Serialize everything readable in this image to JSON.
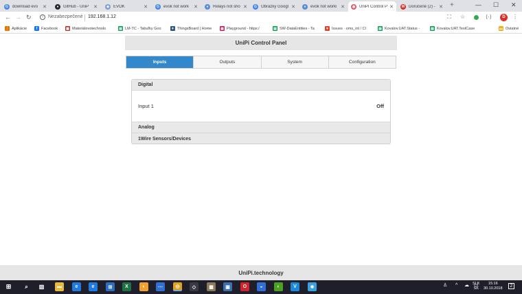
{
  "browser": {
    "tabs": [
      {
        "title": "download evo",
        "favicon": "google-icon",
        "color": "#4285f4",
        "glyph": "G"
      },
      {
        "title": "GitHub - UniP",
        "favicon": "github-icon",
        "color": "#24292e",
        "glyph": "●"
      },
      {
        "title": "EVOK",
        "favicon": "evok-icon",
        "color": "#7aa0d8",
        "glyph": "◆"
      },
      {
        "title": "evok not work",
        "favicon": "google-icon",
        "color": "#4285f4",
        "glyph": "G"
      },
      {
        "title": "Relays not sho",
        "favicon": "forum-icon",
        "color": "#5b8dd6",
        "glyph": "♦"
      },
      {
        "title": "Obrázky Googl",
        "favicon": "google-icon",
        "color": "#4285f4",
        "glyph": "G"
      },
      {
        "title": "evok not worki",
        "favicon": "forum-icon",
        "color": "#5b8dd6",
        "glyph": "♦"
      },
      {
        "title": "UniPi Control P",
        "favicon": "unipi-icon",
        "color": "#e05a6a",
        "glyph": "◉",
        "active": true
      },
      {
        "title": "Doručené (2) -",
        "favicon": "gmail-icon",
        "color": "#d93025",
        "glyph": "M"
      }
    ],
    "address": {
      "insecure_label": "Nezabezpečené",
      "url": "192.168.1.12"
    },
    "profile_initial": "D",
    "bookmarks": [
      {
        "label": "Aplikácie",
        "color": "#e37400",
        "glyph": "⋮"
      },
      {
        "label": "Facebook",
        "color": "#1877f2",
        "glyph": "f"
      },
      {
        "label": "Materiálovotechnolo",
        "color": "#b03a2e",
        "glyph": "▦"
      },
      {
        "label": "LM-TC - Tabuľky Goo",
        "color": "#0f9d58",
        "glyph": "▤"
      },
      {
        "label": "ThingsBoard | Home",
        "color": "#305680",
        "glyph": "✦"
      },
      {
        "label": "Playground - https:/",
        "color": "#c2185b",
        "glyph": "▣"
      },
      {
        "label": "SW-DataEntities - Ta",
        "color": "#0f9d58",
        "glyph": "▤"
      },
      {
        "label": "Issues · oms_int / Cl",
        "color": "#e24329",
        "glyph": "▼"
      },
      {
        "label": "Kovalov.UAT.Status -",
        "color": "#0f9d58",
        "glyph": "▤"
      },
      {
        "label": "Kovalov.UAT.TestCase",
        "color": "#0f9d58",
        "glyph": "▤"
      },
      {
        "label": "Ostatné",
        "color": "#f2b01e",
        "glyph": "▬"
      }
    ]
  },
  "app": {
    "title": "UniPi Control Panel",
    "nav": [
      {
        "label": "Inputs",
        "active": true
      },
      {
        "label": "Outputs"
      },
      {
        "label": "System"
      },
      {
        "label": "Configuration"
      }
    ],
    "sections": {
      "digital": "Digital",
      "analog": "Analog",
      "wire": "1Wire Sensors/Devices"
    },
    "inputs": [
      {
        "name": "Input 1",
        "state": "Off"
      }
    ],
    "footer": "UniPi.technology"
  },
  "taskbar": {
    "apps": [
      {
        "name": "explorer-icon",
        "color": "#e8b93a",
        "glyph": "▬"
      },
      {
        "name": "edge-icon",
        "color": "#1e7be0",
        "glyph": "e"
      },
      {
        "name": "edge-icon",
        "color": "#1e7be0",
        "glyph": "e"
      },
      {
        "name": "store-icon",
        "color": "#2d6ec2",
        "glyph": "⊞"
      },
      {
        "name": "excel-icon",
        "color": "#1e7145",
        "glyph": "X"
      },
      {
        "name": "paint-icon",
        "color": "#f0a030",
        "glyph": "◐"
      },
      {
        "name": "chat-icon",
        "color": "#2f6fd6",
        "glyph": "⋯"
      },
      {
        "name": "chrome-icon",
        "color": "#e0a020",
        "glyph": "◎",
        "active": true
      },
      {
        "name": "code-icon",
        "color": "#3a3a44",
        "glyph": "◇"
      },
      {
        "name": "archive-icon",
        "color": "#8a7a5a",
        "glyph": "▦"
      },
      {
        "name": "app-icon",
        "color": "#3a6fb0",
        "glyph": "▣"
      },
      {
        "name": "opera-icon",
        "color": "#d0232a",
        "glyph": "O"
      },
      {
        "name": "photos-icon",
        "color": "#2f6fd6",
        "glyph": "◒"
      },
      {
        "name": "app-icon",
        "color": "#4aa020",
        "glyph": "◐"
      },
      {
        "name": "vscode-icon",
        "color": "#1e88d8",
        "glyph": "V"
      },
      {
        "name": "app-icon",
        "color": "#3aa0e0",
        "glyph": "✸"
      }
    ],
    "language": {
      "top": "SLK",
      "bottom": "SK"
    },
    "clock": {
      "time": "15:16",
      "date": "30.10.2018"
    },
    "notifications": "2"
  }
}
